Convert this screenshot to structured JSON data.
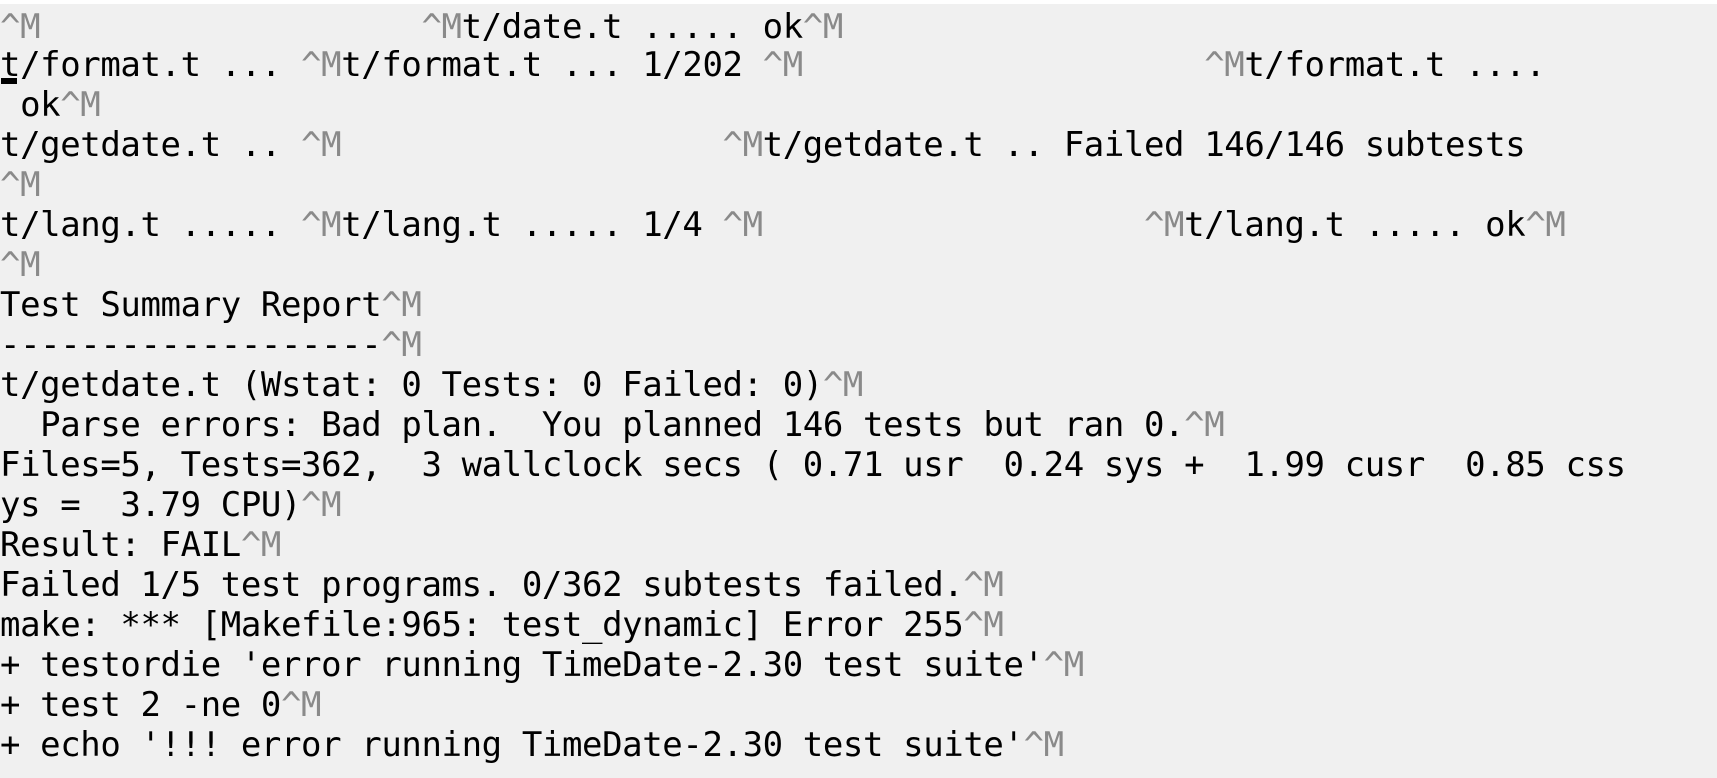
{
  "terminal": {
    "lines": [
      {
        "t1": "",
        "c1": "^M",
        "t2": "                   ",
        "c2": "^M",
        "t3": "t/date.t ..... ok",
        "c3": "^M"
      },
      {
        "t1": "t/format.t ... ",
        "c1": "^M",
        "t2": "t/format.t ... 1/202 ",
        "c2": "^M",
        "t3": "                    ",
        "c3": "^M",
        "t4": "t/format.t ...."
      },
      {
        "t1": " ok",
        "c1": "^M"
      },
      {
        "t1": "t/getdate.t .. ",
        "c1": "^M",
        "t2": "                   ",
        "c2": "^M",
        "t3": "t/getdate.t .. Failed 146/146 subtests"
      },
      {
        "c1": "^M"
      },
      {
        "t1": "t/lang.t ..... ",
        "c1": "^M",
        "t2": "t/lang.t ..... 1/4 ",
        "c2": "^M",
        "t3": "                   ",
        "c3": "^M",
        "t4": "t/lang.t ..... ok",
        "c4": "^M"
      },
      {
        "c1": "^M"
      },
      {
        "t1": "Test Summary Report",
        "c1": "^M"
      },
      {
        "t1": "-------------------",
        "c1": "^M"
      },
      {
        "t1": "t/getdate.t (Wstat: 0 Tests: 0 Failed: 0)",
        "c1": "^M"
      },
      {
        "t1": "  Parse errors: Bad plan.  You planned 146 tests but ran 0.",
        "c1": "^M"
      },
      {
        "t1": "Files=5, Tests=362,  3 wallclock secs ( 0.71 usr  0.24 sys +  1.99 cusr  0.85 css"
      },
      {
        "t1": "ys =  3.79 CPU)",
        "c1": "^M"
      },
      {
        "t1": "Result: FAIL",
        "c1": "^M"
      },
      {
        "t1": "Failed 1/5 test programs. 0/362 subtests failed.",
        "c1": "^M"
      },
      {
        "t1": "make: *** [Makefile:965: test_dynamic] Error 255",
        "c1": "^M"
      },
      {
        "t1": "+ testordie 'error running TimeDate-2.30 test suite'",
        "c1": "^M"
      },
      {
        "t1": "+ test 2 -ne 0",
        "c1": "^M"
      },
      {
        "t1": "+ echo '!!! error running TimeDate-2.30 test suite'",
        "c1": "^M"
      }
    ]
  }
}
